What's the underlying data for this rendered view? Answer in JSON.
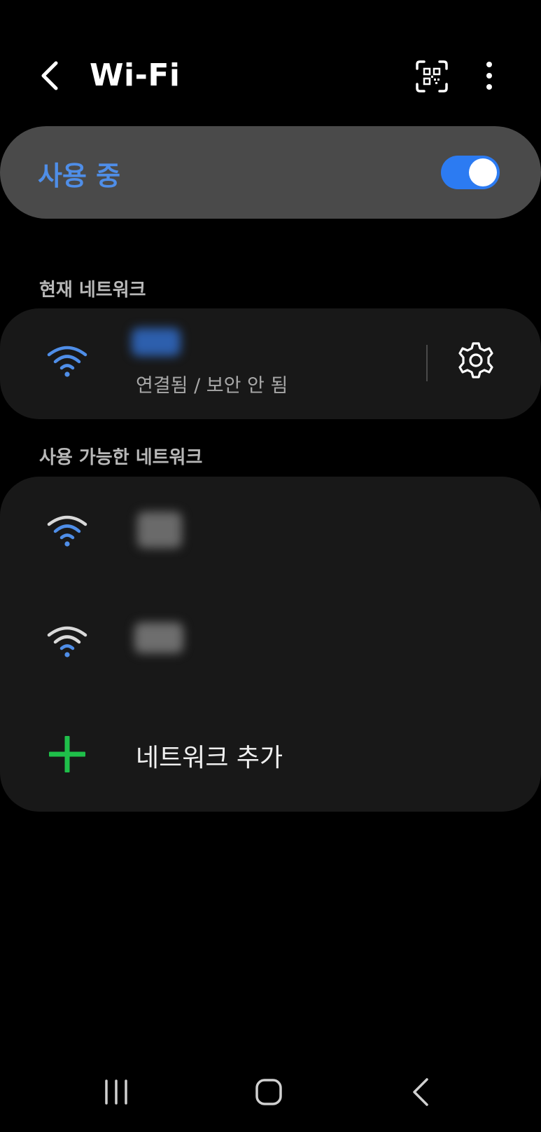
{
  "header": {
    "title": "Wi-Fi"
  },
  "master_toggle": {
    "label": "사용 중",
    "state": "on",
    "accent_color": "#2c7bf2"
  },
  "current_network": {
    "section_title": "현재 네트워크",
    "status": "연결됨 / 보안 안 됨",
    "icon": "wifi-full-icon"
  },
  "available_networks": {
    "section_title": "사용 가능한 네트워크",
    "items": [
      {
        "icon": "wifi-signal-3-icon"
      },
      {
        "icon": "wifi-signal-2-icon"
      }
    ],
    "add_label": "네트워크 추가"
  },
  "icons": {
    "back": "back-arrow-icon",
    "qr": "qr-scan-icon",
    "more": "more-vertical-icon",
    "settings": "gear-icon",
    "add": "plus-icon"
  },
  "colors": {
    "wifi_blue": "#4f8ee8",
    "wifi_inactive": "#d9d9d9",
    "add_green": "#1fbf4a"
  }
}
